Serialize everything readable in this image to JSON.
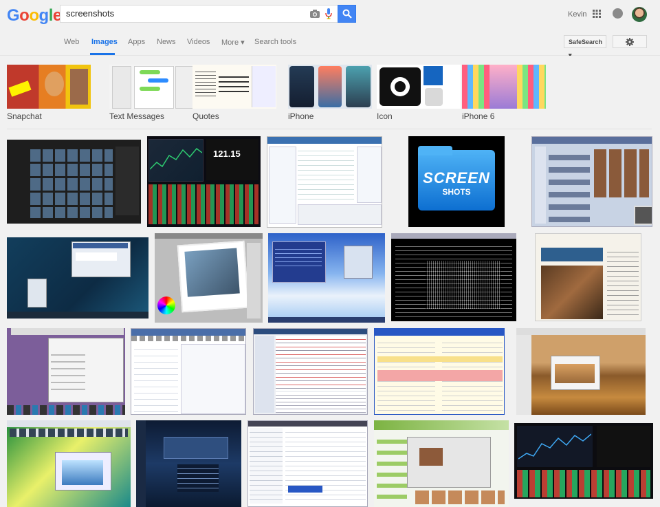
{
  "logo": {
    "letters": [
      "G",
      "o",
      "o",
      "g",
      "l",
      "e"
    ],
    "colors": [
      "#4285f4",
      "#ea4335",
      "#fbbc05",
      "#4285f4",
      "#34a853",
      "#ea4335"
    ]
  },
  "search": {
    "value": "screenshots"
  },
  "header": {
    "user_name": "Kevin"
  },
  "nav": {
    "tabs": [
      {
        "label": "Web"
      },
      {
        "label": "Images"
      },
      {
        "label": "Apps"
      },
      {
        "label": "News"
      },
      {
        "label": "Videos"
      },
      {
        "label": "More ▾"
      },
      {
        "label": "Search tools"
      }
    ],
    "active_tab": "Images",
    "safesearch_label": "SafeSearch ▾"
  },
  "categories": [
    {
      "label": "Snapchat"
    },
    {
      "label": "Text Messages"
    },
    {
      "label": "Quotes"
    },
    {
      "label": "iPhone"
    },
    {
      "label": "Icon"
    },
    {
      "label": "iPhone 6"
    }
  ],
  "screen_shots_tile": {
    "line1": "SCREEN",
    "line2": "SHOTS"
  },
  "accent_colors": {
    "google_blue": "#4285f4",
    "active_tab": "#1a73e8"
  }
}
